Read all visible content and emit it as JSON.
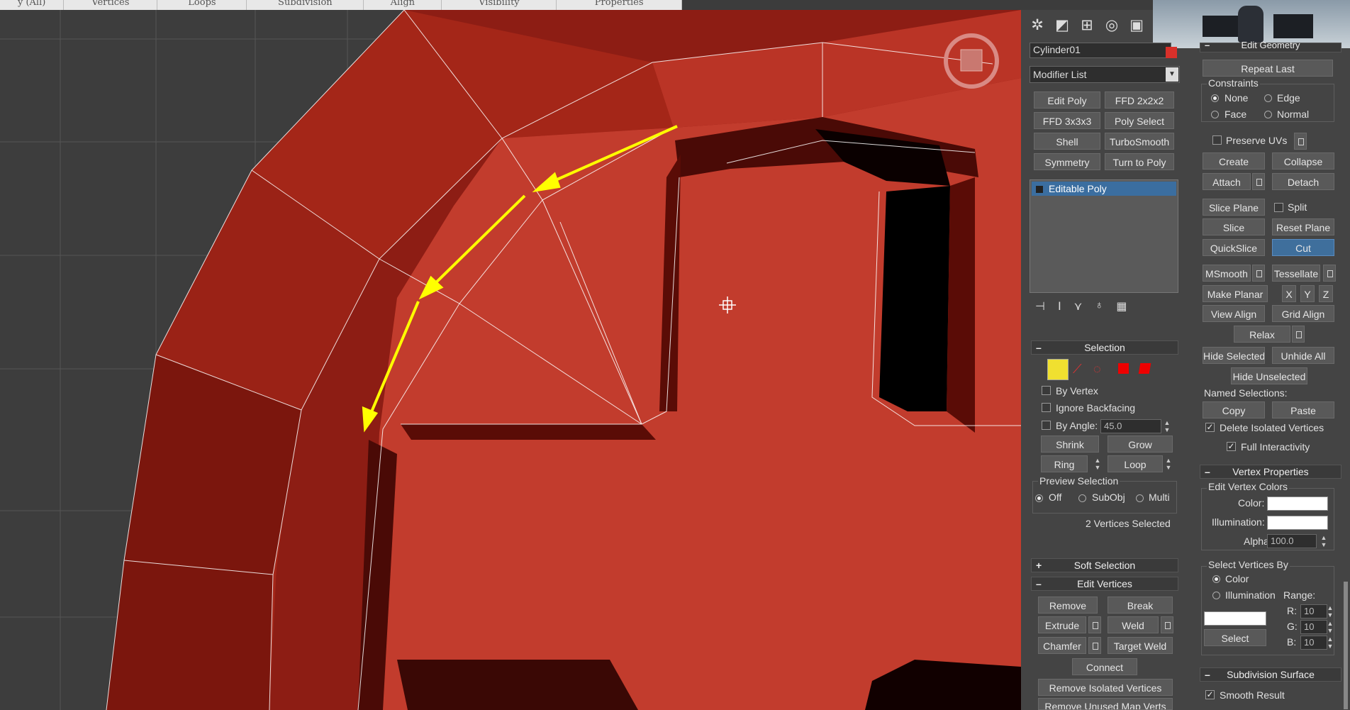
{
  "menu_tabs": [
    {
      "label": "y (All)",
      "w": 90
    },
    {
      "label": "Vertices",
      "w": 132
    },
    {
      "label": "Loops",
      "w": 126
    },
    {
      "label": "Subdivision",
      "w": 165
    },
    {
      "label": "Align",
      "w": 110
    },
    {
      "label": "Visibility",
      "w": 162
    },
    {
      "label": "Properties",
      "w": 177
    }
  ],
  "command_panel": {
    "object_name": "Cylinder01",
    "modifier_list": "Modifier List",
    "modifier_buttons": [
      "Edit Poly",
      "FFD 2x2x2",
      "FFD 3x3x3",
      "Poly Select",
      "Shell",
      "TurboSmooth",
      "Symmetry",
      "Turn to Poly"
    ],
    "stack_item": "Editable Poly"
  },
  "selection": {
    "title": "Selection",
    "by_vertex": "By Vertex",
    "ignore_backfacing": "Ignore Backfacing",
    "by_angle": "By Angle:",
    "angle_value": "45.0",
    "shrink": "Shrink",
    "grow": "Grow",
    "ring": "Ring",
    "loop": "Loop",
    "preview_title": "Preview Selection",
    "preview_off": "Off",
    "preview_subobj": "SubObj",
    "preview_multi": "Multi",
    "status": "2 Vertices Selected"
  },
  "soft_selection": {
    "title": "Soft Selection"
  },
  "edit_vertices": {
    "title": "Edit Vertices",
    "remove": "Remove",
    "break": "Break",
    "extrude": "Extrude",
    "weld": "Weld",
    "chamfer": "Chamfer",
    "target_weld": "Target Weld",
    "connect": "Connect",
    "remove_isolated": "Remove Isolated Vertices",
    "remove_unused": "Remove Unused Map Verts"
  },
  "edit_geometry": {
    "title": "Edit Geometry",
    "repeat_last": "Repeat Last",
    "constraints": "Constraints",
    "none": "None",
    "edge": "Edge",
    "face": "Face",
    "normal": "Normal",
    "preserve_uvs": "Preserve UVs",
    "create": "Create",
    "collapse": "Collapse",
    "attach": "Attach",
    "detach": "Detach",
    "slice_plane": "Slice Plane",
    "split": "Split",
    "slice": "Slice",
    "reset_plane": "Reset Plane",
    "quickslice": "QuickSlice",
    "cut": "Cut",
    "msmooth": "MSmooth",
    "tessellate": "Tessellate",
    "make_planar": "Make Planar",
    "x": "X",
    "y": "Y",
    "z": "Z",
    "view_align": "View Align",
    "grid_align": "Grid Align",
    "relax": "Relax",
    "hide_selected": "Hide Selected",
    "unhide_all": "Unhide All",
    "hide_unselected": "Hide Unselected",
    "named_selections": "Named Selections:",
    "copy": "Copy",
    "paste": "Paste",
    "delete_isolated": "Delete Isolated Vertices",
    "full_interactivity": "Full Interactivity"
  },
  "vertex_properties": {
    "title": "Vertex Properties",
    "edit_vertex_colors": "Edit Vertex Colors",
    "color": "Color:",
    "illumination": "Illumination:",
    "alpha": "Alpha:",
    "alpha_value": "100.0",
    "select_by": "Select Vertices By",
    "by_color": "Color",
    "by_illumination": "Illumination",
    "range": "Range:",
    "r": "R:",
    "g": "G:",
    "b": "B:",
    "r_val": "10",
    "g_val": "10",
    "b_val": "10",
    "select": "Select"
  },
  "subdivision_surface": {
    "title": "Subdivision Surface",
    "smooth_result": "Smooth Result"
  },
  "colors": {
    "viewport_bg": "#3d3d3d",
    "mesh": "#b33428",
    "arrow": "#ffff00",
    "active": "#3f6f9c"
  }
}
